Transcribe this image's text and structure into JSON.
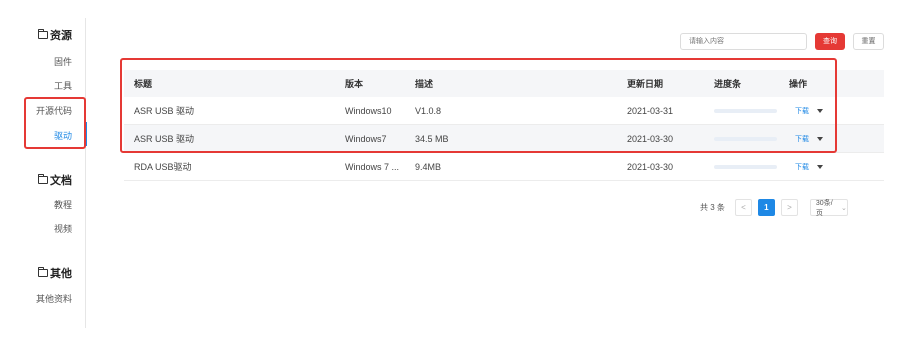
{
  "sidebar": {
    "sections": [
      {
        "title": "资源",
        "items": [
          "固件",
          "工具",
          "开源代码",
          "驱动"
        ]
      },
      {
        "title": "文档",
        "items": [
          "教程",
          "视频"
        ]
      },
      {
        "title": "其他",
        "items": [
          "其他资料"
        ]
      }
    ],
    "active_item": "驱动"
  },
  "search": {
    "placeholder": "请输入内容",
    "search_label": "查询",
    "reset_label": "重置"
  },
  "table": {
    "headers": {
      "title": "标题",
      "version": "版本",
      "description": "描述",
      "date": "更新日期",
      "progress": "进度条",
      "action": "操作"
    },
    "rows": [
      {
        "title": "ASR USB 驱动",
        "version": "Windows10",
        "description": "V1.0.8",
        "date": "2021-03-31",
        "progress": 0,
        "action": "下载"
      },
      {
        "title": "ASR USB 驱动",
        "version": "Windows7",
        "description": "34.5 MB",
        "date": "2021-03-30",
        "progress": 0,
        "action": "下载"
      },
      {
        "title": "RDA USB驱动",
        "version": "Windows 7 ...",
        "description": "9.4MB",
        "date": "2021-03-30",
        "progress": 0,
        "action": "下载"
      }
    ]
  },
  "pagination": {
    "total_text": "共 3 条",
    "prev": "<",
    "current_page": "1",
    "next": ">",
    "page_size": "30条/页"
  },
  "colors": {
    "accent": "#1e88e5",
    "brand_red": "#e53935",
    "annotation_red": "#e53935"
  },
  "icons": {
    "section": "folder-icon",
    "op_dropdown": "caret-down-icon",
    "page_size": "chevron-down-icon"
  }
}
